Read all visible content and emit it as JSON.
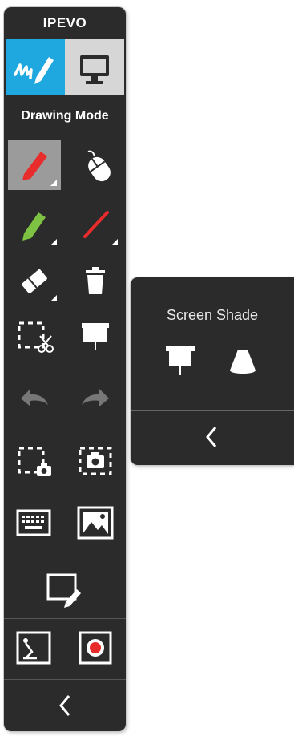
{
  "toolbar": {
    "brand": "IPEVO",
    "mode_title": "Drawing Mode",
    "modes": [
      {
        "name": "drawing",
        "icon": "pen-signature-icon",
        "active": true
      },
      {
        "name": "screen",
        "icon": "monitor-icon",
        "active": false
      }
    ],
    "tools": [
      {
        "icon": "red-pen-icon",
        "selected": true
      },
      {
        "icon": "mouse-cursor-icon",
        "selected": false
      },
      {
        "icon": "green-highlighter-icon",
        "selected": false
      },
      {
        "icon": "red-line-icon",
        "selected": false
      },
      {
        "icon": "eraser-icon",
        "selected": false
      },
      {
        "icon": "trash-icon",
        "selected": false
      },
      {
        "icon": "cut-selection-icon",
        "selected": false
      },
      {
        "icon": "screen-shade-icon",
        "selected": false
      },
      {
        "icon": "undo-icon",
        "disabled": true
      },
      {
        "icon": "redo-icon",
        "disabled": true
      },
      {
        "icon": "region-capture-icon",
        "selected": false
      },
      {
        "icon": "fullscreen-capture-icon",
        "selected": false
      },
      {
        "icon": "keyboard-icon",
        "selected": false
      },
      {
        "icon": "image-icon",
        "selected": false
      },
      {
        "icon": "whiteboard-icon",
        "selected": false
      },
      {
        "icon": "doc-camera-icon",
        "selected": false
      },
      {
        "icon": "record-icon",
        "selected": false
      },
      {
        "icon": "collapse-chevron-left-icon",
        "selected": false
      }
    ],
    "colors": {
      "background": "#2b2b2b",
      "accent": "#1fa8e0",
      "pen_red": "#e82c2c",
      "pen_green": "#7dc242",
      "selected": "#9b9b9b"
    }
  },
  "flyout": {
    "title": "Screen Shade",
    "items": [
      {
        "icon": "projector-screen-icon"
      },
      {
        "icon": "spotlight-icon"
      }
    ],
    "close_icon": "chevron-left-icon"
  }
}
